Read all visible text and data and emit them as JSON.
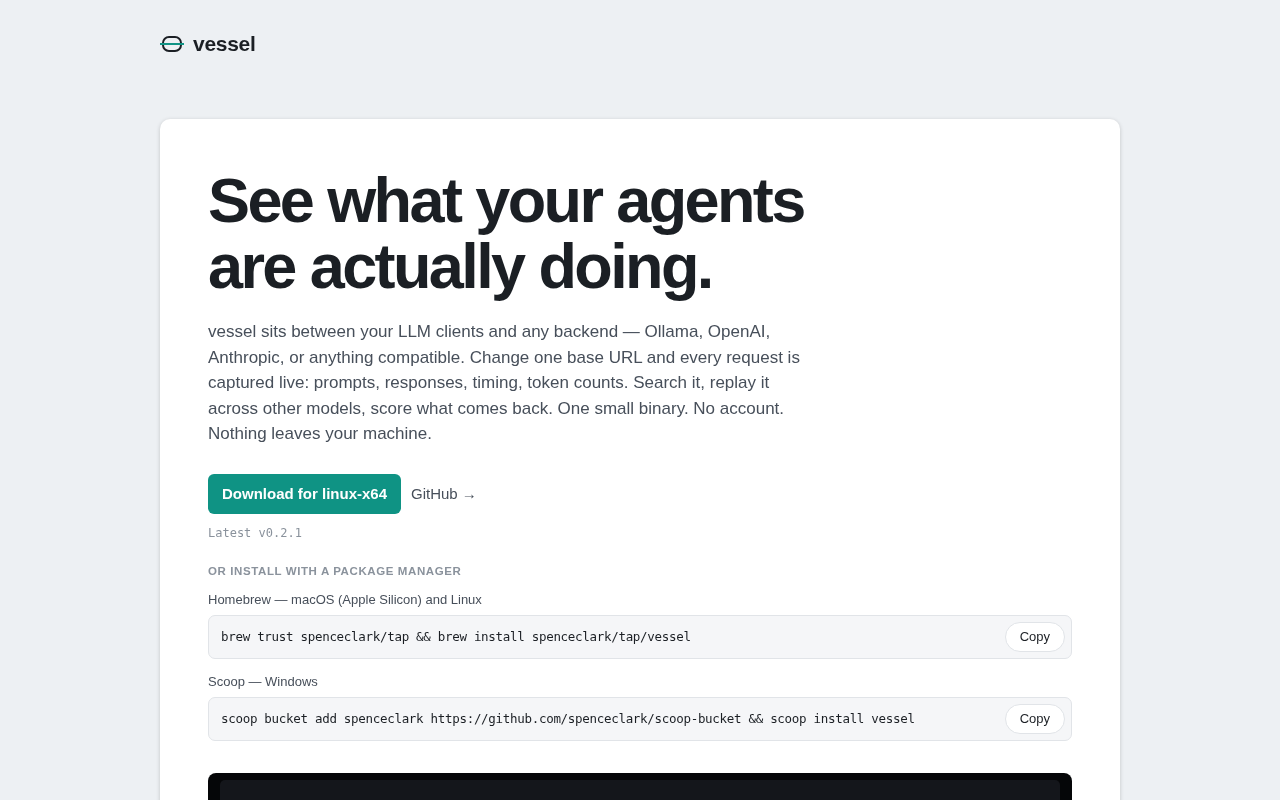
{
  "brand": {
    "name": "vessel"
  },
  "hero": {
    "headline_lines": [
      "See what your agents",
      "are actually doing."
    ],
    "description": "vessel sits between your LLM clients and any backend — Ollama, OpenAI, Anthropic, or anything compatible. Change one base URL and every request is captured live: prompts, responses, timing, token counts. Search it, replay it across other models, score what comes back. One small binary. No account. Nothing leaves your machine.",
    "download_button": "Download for linux-x64",
    "github_link": "GitHub →",
    "version": "Latest v0.2.1"
  },
  "install": {
    "heading": "OR INSTALL WITH A PACKAGE MANAGER",
    "options": [
      {
        "label": "Homebrew — macOS (Apple Silicon) and Linux",
        "command": "brew trust spenceclark/tap && brew install spenceclark/tap/vessel",
        "button": "Copy"
      },
      {
        "label": "Scoop — Windows",
        "command": "scoop bucket add spenceclark https://github.com/spenceclark/scoop-bucket && scoop install vessel",
        "button": "Copy"
      }
    ]
  }
}
